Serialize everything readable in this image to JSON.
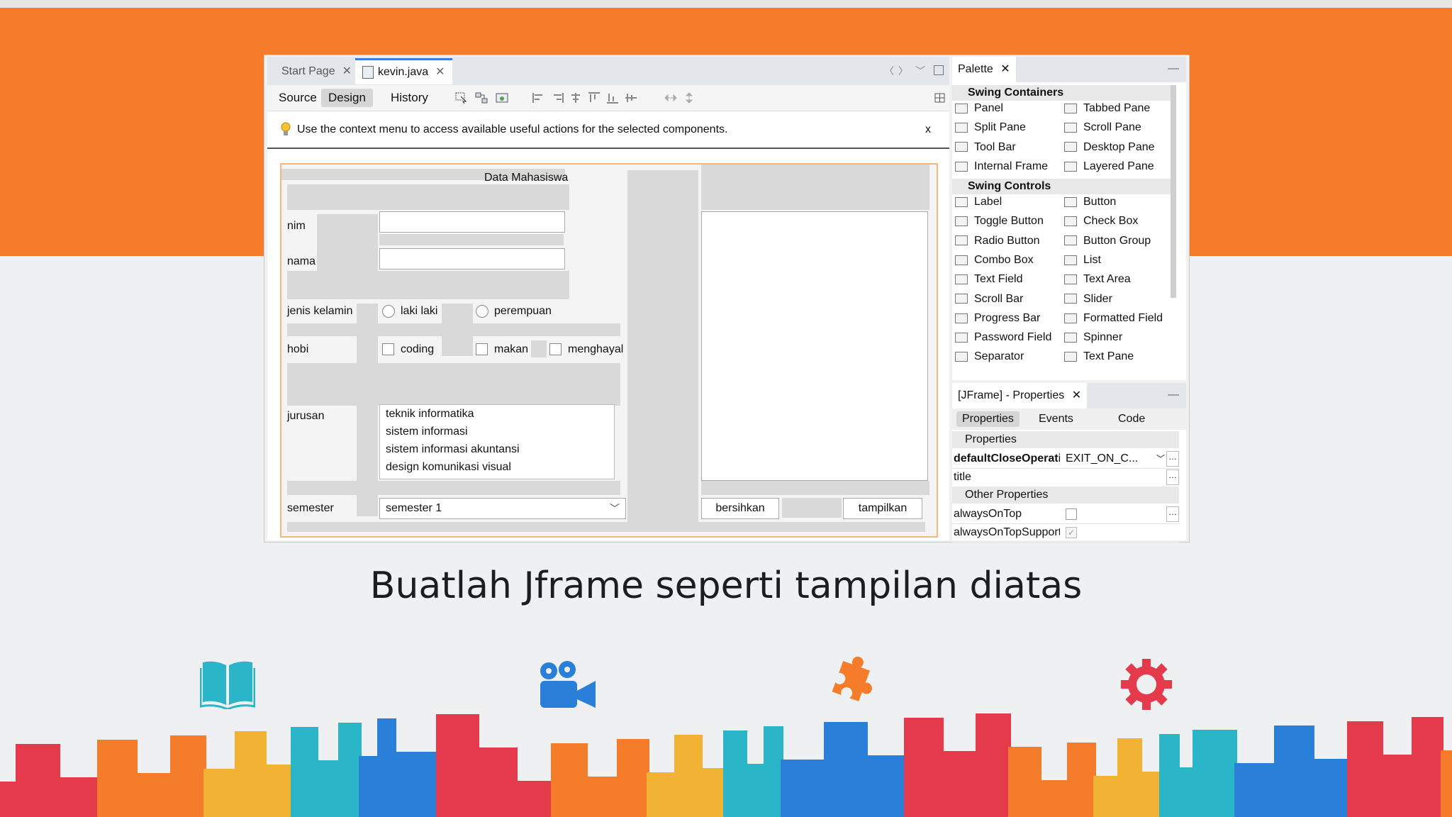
{
  "slide": {
    "caption": "Buatlah Jframe seperti tampilan diatas",
    "icons": [
      "book-open-icon",
      "video-camera-icon",
      "puzzle-piece-icon",
      "gear-icon"
    ],
    "colors": {
      "orange": "#f47c2b",
      "teal": "#2bb5c9",
      "blue": "#2a7fd9",
      "red": "#e43a4b"
    }
  },
  "ide": {
    "tabs": [
      {
        "label": "Start Page",
        "close": "✕"
      },
      {
        "label": "kevin.java",
        "close": "✕"
      }
    ],
    "modes": [
      "Source",
      "Design",
      "History"
    ],
    "hint": {
      "text": "Use the context menu to access available useful actions for the selected components.",
      "close": "x"
    },
    "form": {
      "title": "Data Mahasiswa",
      "labels": {
        "nim": "nim",
        "nama": "nama",
        "jenis_kelamin": "jenis kelamin",
        "hobi": "hobi",
        "jurusan": "jurusan",
        "semester": "semester"
      },
      "radios": [
        "laki laki",
        "perempuan"
      ],
      "checkboxes": [
        "coding",
        "makan",
        "menghayal"
      ],
      "jurusan_items": [
        "teknik informatika",
        "sistem informasi",
        "sistem informasi akuntansi",
        "design komunikasi visual"
      ],
      "semester_value": "semester 1",
      "buttons": {
        "clear": "bersihkan",
        "show": "tampilkan"
      }
    }
  },
  "palette": {
    "title": "Palette",
    "close": "✕",
    "minimize": "—",
    "sections": [
      {
        "name": "Swing Containers",
        "items": [
          "Panel",
          "Tabbed Pane",
          "Split Pane",
          "Scroll Pane",
          "Tool Bar",
          "Desktop Pane",
          "Internal Frame",
          "Layered Pane"
        ]
      },
      {
        "name": "Swing Controls",
        "items": [
          "Label",
          "Button",
          "Toggle Button",
          "Check Box",
          "Radio Button",
          "Button Group",
          "Combo Box",
          "List",
          "Text Field",
          "Text Area",
          "Scroll Bar",
          "Slider",
          "Progress Bar",
          "Formatted Field",
          "Password Field",
          "Spinner",
          "Separator",
          "Text Pane"
        ]
      }
    ]
  },
  "properties": {
    "title": "[JFrame] - Properties",
    "close": "✕",
    "tabs": [
      "Properties",
      "Events",
      "Code"
    ],
    "section1": "Properties",
    "rows1": [
      {
        "key": "defaultCloseOperati",
        "value": "EXIT_ON_C..."
      },
      {
        "key": "title",
        "value": ""
      }
    ],
    "section2": "Other Properties",
    "rows2": [
      {
        "key": "alwaysOnTop",
        "value": ""
      },
      {
        "key": "alwaysOnTopSupport",
        "value": "✓"
      }
    ]
  }
}
